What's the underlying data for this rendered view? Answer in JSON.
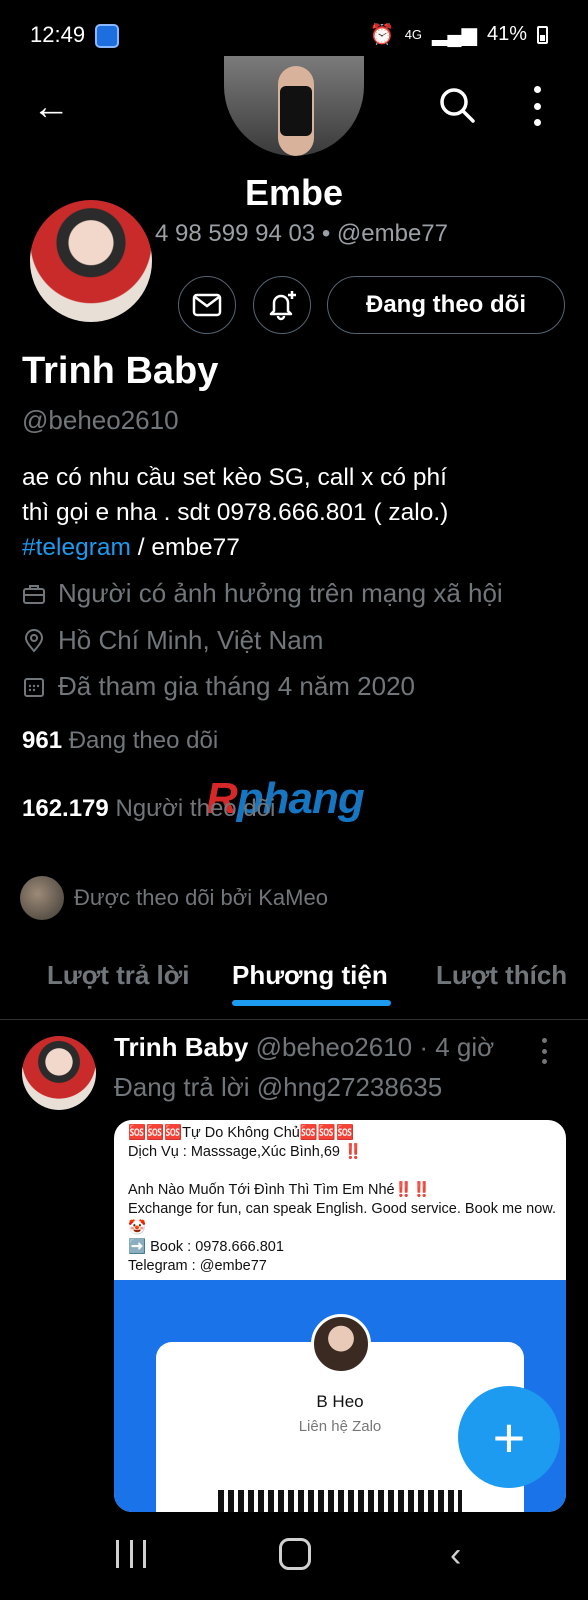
{
  "status_bar": {
    "time": "12:49",
    "network": "4G",
    "battery": "41%"
  },
  "header": {
    "title": "Embe",
    "subtitle": "4 98 599 94 03 • @embe77",
    "icons": [
      "back-arrow-icon",
      "search-icon",
      "more-vertical-icon"
    ]
  },
  "profile": {
    "name": "Trinh Baby",
    "handle": "@beheo2610",
    "follow_button": "Đang theo dõi",
    "bio_text": "ae có nhu cầu set kèo SG, call x có phí\nthì gọi e nha .    sdt 0978.666.801 ( zalo.)",
    "bio_hashtag": "#telegram",
    "bio_suffix": " / embe77",
    "category": "Người có ảnh hưởng trên mạng xã hội",
    "location": "Hồ Chí Minh, Việt Nam",
    "joined": "Đã tham gia tháng 4 năm 2020",
    "following_count": "961",
    "following_label": "Đang theo dõi",
    "followers_count": "162.179",
    "followers_label": "Người theo dõi",
    "followed_by": "Được theo dõi bởi KaMeo"
  },
  "watermark": {
    "first": "R",
    "rest": "phang"
  },
  "tabs": [
    {
      "label": "Lượt trả lời",
      "active": false
    },
    {
      "label": "Phương tiện",
      "active": true
    },
    {
      "label": "Lượt thích",
      "active": false
    }
  ],
  "post": {
    "author": "Trinh Baby",
    "handle_time": "@beheo2610 · 4 giờ",
    "reply_to": "Đang trả lời @hng27238635",
    "media_text": "🆘🆘🆘Tự Do Không Chủ🆘🆘🆘\nDịch Vụ : Masssage,Xúc Bình,69 ‼️\n\nAnh Nào Muốn Tới Đình Thì Tìm Em Nhé‼️‼️\nExchange for fun, can speak English. Good service. Book me now. 🤡\n➡️ Book : 0978.666.801\nTelegram : @embe77",
    "card_name": "B Heo",
    "card_sub": "Liên hệ Zalo"
  },
  "fab_label": "+",
  "colors": {
    "accent": "#1d9bf0",
    "background": "#000000",
    "muted": "#71767b"
  }
}
